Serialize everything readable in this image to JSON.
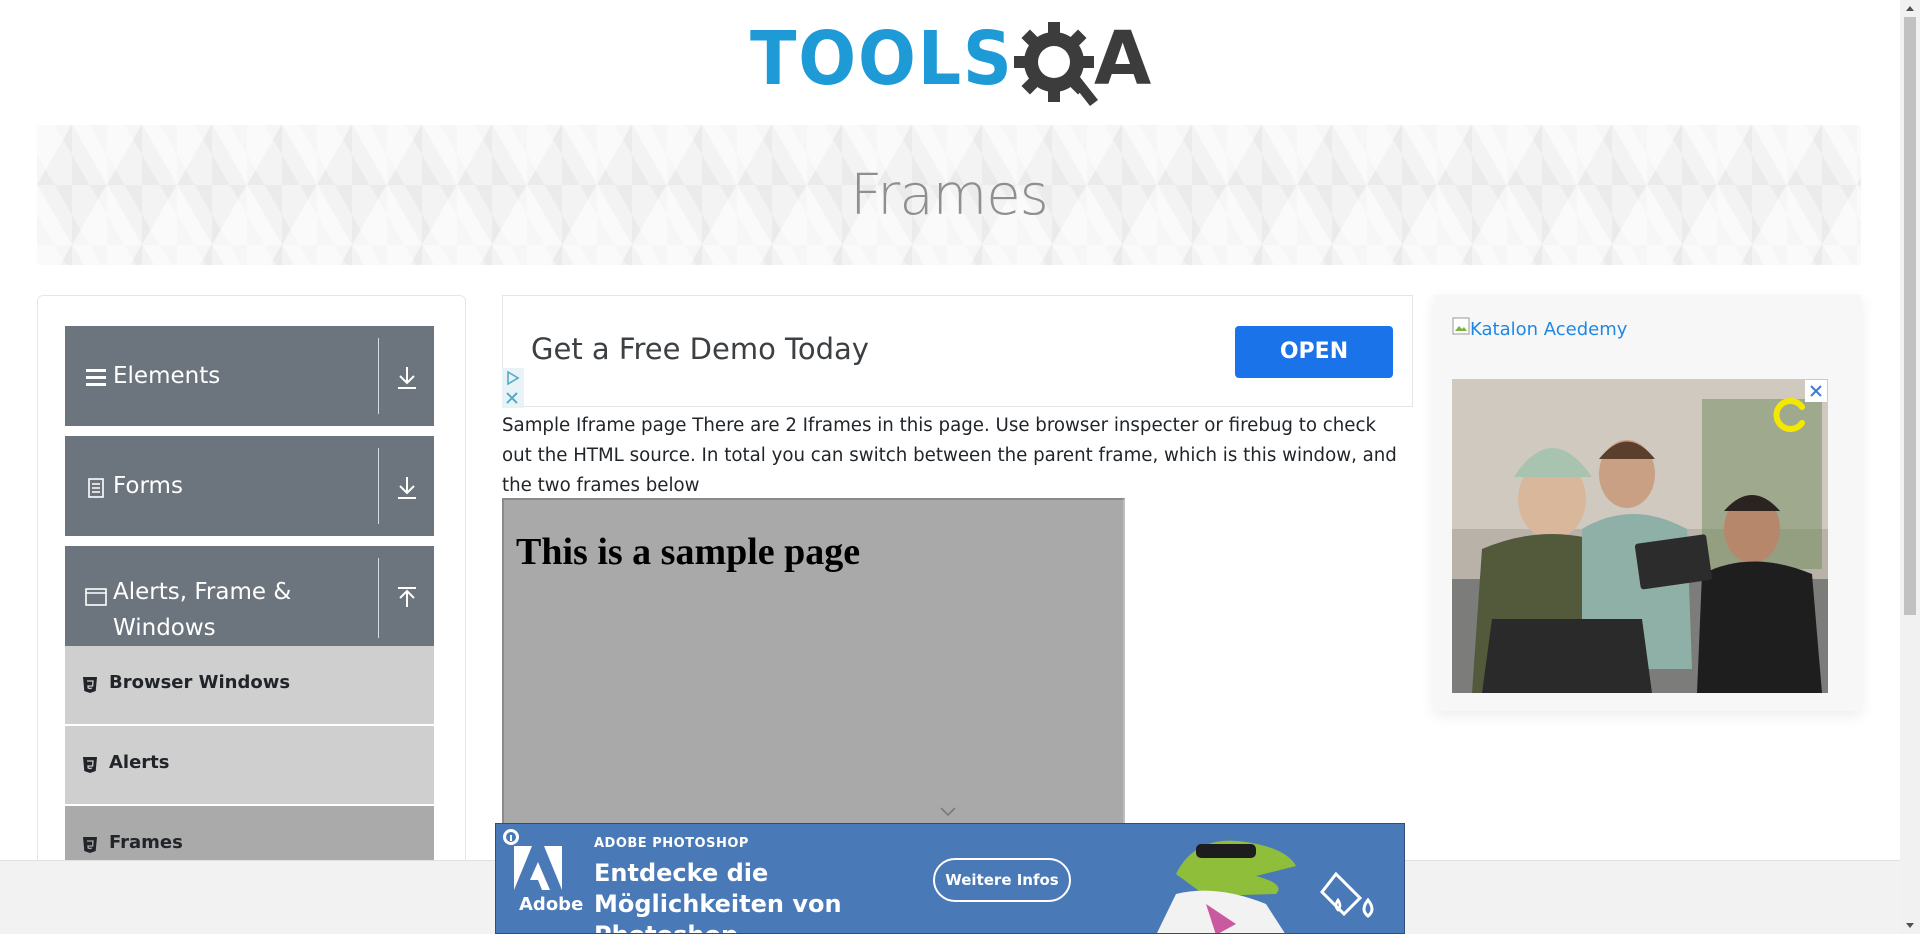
{
  "header": {
    "logo_text": "TOOLS",
    "logo_suffix": "A",
    "page_title": "Frames"
  },
  "sidebar": {
    "groups": [
      {
        "label": "Elements",
        "icon": "hamburger-icon",
        "arrow": "download-arrow-icon"
      },
      {
        "label": "Forms",
        "icon": "document-icon",
        "arrow": "download-arrow-icon"
      },
      {
        "label": "Alerts, Frame &",
        "label_line2": "Windows",
        "icon": "window-icon",
        "arrow": "upload-arrow-icon"
      }
    ],
    "items": [
      {
        "label": "Browser Windows",
        "icon": "html5-icon",
        "active": false
      },
      {
        "label": "Alerts",
        "icon": "html5-icon",
        "active": false
      },
      {
        "label": "Frames",
        "icon": "html5-icon",
        "active": true
      }
    ]
  },
  "ad_top": {
    "headline": "Get a Free Demo Today",
    "button": "OPEN"
  },
  "description": "Sample Iframe page There are 2 Iframes in this page. Use browser inspecter or firebug to check out the HTML source. In total you can switch between the parent frame, which is this window, and the two frames below",
  "frame": {
    "heading": "This is a sample page"
  },
  "right_ad": {
    "alt_text": "Katalon Acedemy"
  },
  "bottom_ad": {
    "brand_kicker": "ADOBE PHOTOSHOP",
    "headline": "Entdecke die Möglichkeiten von Photoshop.",
    "button": "Weitere Infos",
    "brand_name": "Adobe"
  },
  "colors": {
    "logo_blue": "#1e9bd7",
    "sidebar_group": "#6c757d",
    "sidebar_item": "#cfcfcf",
    "sidebar_item_active": "#aaaaaa",
    "ad_button": "#1a73e8",
    "bottom_ad_bg": "#4a79b8",
    "link": "#1e88e5"
  }
}
